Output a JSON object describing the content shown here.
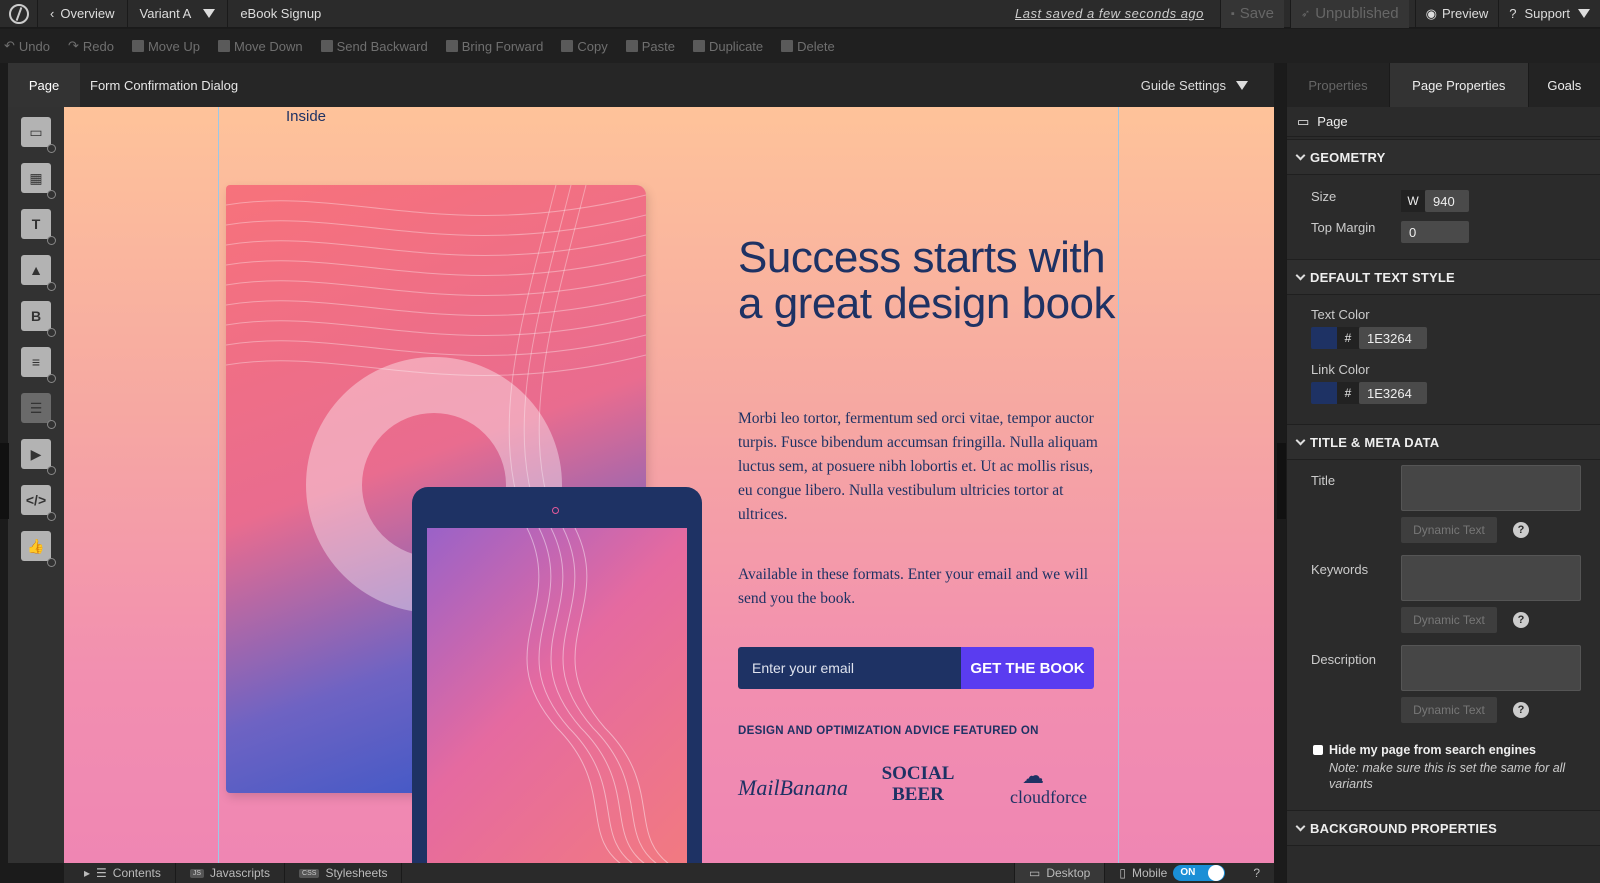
{
  "topbar": {
    "overview": "Overview",
    "variant": "Variant  A",
    "page_name": "eBook Signup",
    "last_saved": "Last saved  a few seconds ago",
    "save": "Save",
    "unpublished": "Unpublished",
    "preview": "Preview",
    "support": "Support"
  },
  "actions": [
    "Undo",
    "Redo",
    "Move Up",
    "Move Down",
    "Send Backward",
    "Bring Forward",
    "Copy",
    "Paste",
    "Duplicate",
    "Delete"
  ],
  "canvas_head": {
    "page_tab": "Page",
    "crumb": "Form Confirmation Dialog",
    "guide_settings": "Guide Settings"
  },
  "landing": {
    "inside": "Inside",
    "headline": "Success starts with a great design book",
    "body": "Morbi leo tortor, fermentum sed orci vitae, tempor auctor turpis. Fusce bibendum accumsan fringilla. Nulla aliquam luctus sem, at posuere nibh lobortis et. Ut ac mollis risus, eu congue libero. Nulla vestibulum ultricies tortor at ultrices.",
    "formats": "Available in these formats. Enter your email and we will send you the book.",
    "email_placeholder": "Enter your email",
    "cta": "GET THE BOOK",
    "featured": "DESIGN AND OPTIMIZATION ADVICE FEATURED ON",
    "logos": [
      "MailBanana",
      "SOCIAL BEER",
      "cloudforce"
    ]
  },
  "bottombar": {
    "contents": "Contents",
    "javascripts": "Javascripts",
    "js_badge": "JS",
    "stylesheets": "Stylesheets",
    "css_badge": "CSS",
    "desktop": "Desktop",
    "mobile": "Mobile",
    "toggle": "ON"
  },
  "panel": {
    "tabs": [
      "Properties",
      "Page Properties",
      "Goals"
    ],
    "page_label": "Page",
    "geometry": "GEOMETRY",
    "size_label": "Size",
    "width_prefix": "W",
    "width_value": "940",
    "top_margin_label": "Top Margin",
    "top_margin_value": "0",
    "default_text_style": "DEFAULT TEXT STYLE",
    "text_color_label": "Text Color",
    "text_color": "1E3264",
    "link_color_label": "Link Color",
    "link_color": "1E3264",
    "title_meta": "TITLE & META DATA",
    "title_label": "Title",
    "keywords_label": "Keywords",
    "description_label": "Description",
    "dynamic_text": "Dynamic Text",
    "hide_label": "Hide my page from search engines",
    "hide_note": "Note: make sure this is set the same for all variants",
    "background": "BACKGROUND PROPERTIES"
  },
  "colors": {
    "navy": "#1E3264",
    "cta": "#5A3CF0"
  }
}
